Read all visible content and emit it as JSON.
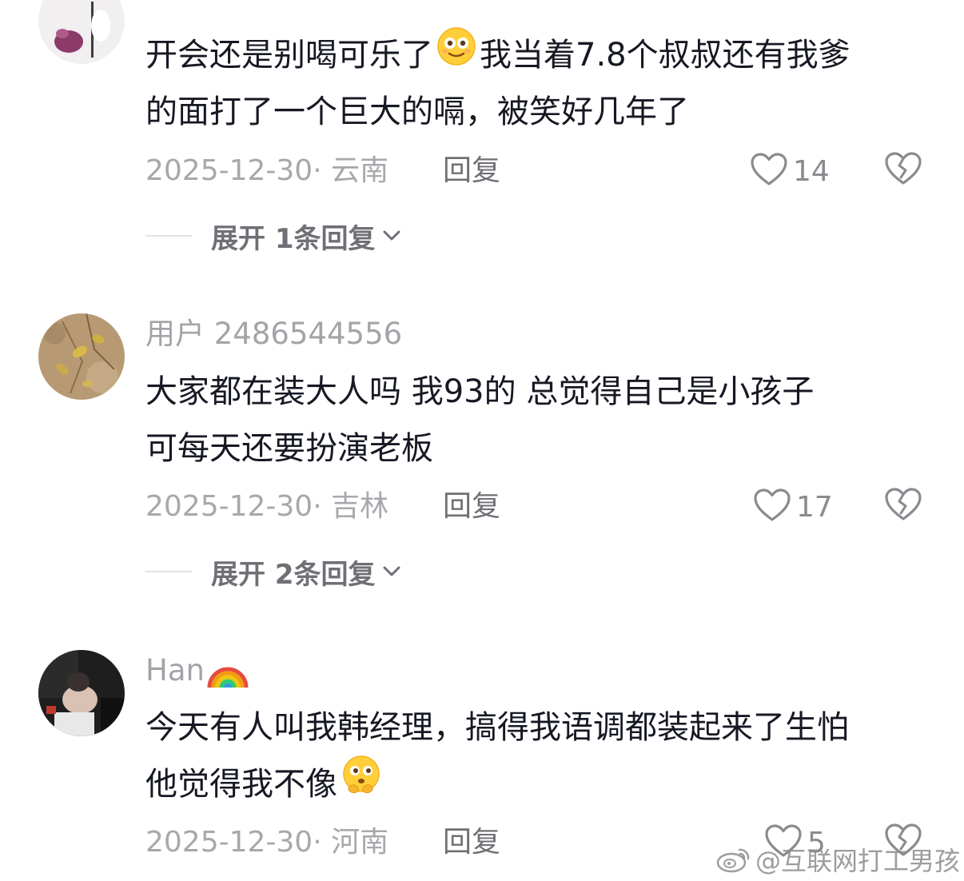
{
  "comments": [
    {
      "username": "",
      "line1_before": "开会还是别喝可乐了",
      "line1_after": "我当着7.8个叔叔还有我爹",
      "line2": "的面打了一个巨大的嗝，被笑好几年了",
      "meta": "2025-12-30· 云南",
      "reply_label": "回复",
      "likes": "14",
      "expand_label": "展开 1条回复",
      "emoji_icon": "smiling-face-emoji"
    },
    {
      "username": "用户 2486544556",
      "line1": "大家都在装大人吗 我93的 总觉得自己是小孩子",
      "line2": "可每天还要扮演老板",
      "meta": "2025-12-30· 吉林",
      "reply_label": "回复",
      "likes": "17",
      "expand_label": "展开 2条回复"
    },
    {
      "username": "Han",
      "username_icon": "rainbow-emoji",
      "line1": "今天有人叫我韩经理，搞得我语调都装起来了生怕",
      "line2": "他觉得我不像",
      "meta": "2025-12-30· 河南",
      "reply_label": "回复",
      "likes": "5",
      "emoji_icon": "thinking-face-emoji"
    }
  ],
  "watermark": "@互联网打工男孩",
  "colors": {
    "text": "#161823",
    "meta": "#a7a8ac",
    "reply": "#6f7075"
  }
}
